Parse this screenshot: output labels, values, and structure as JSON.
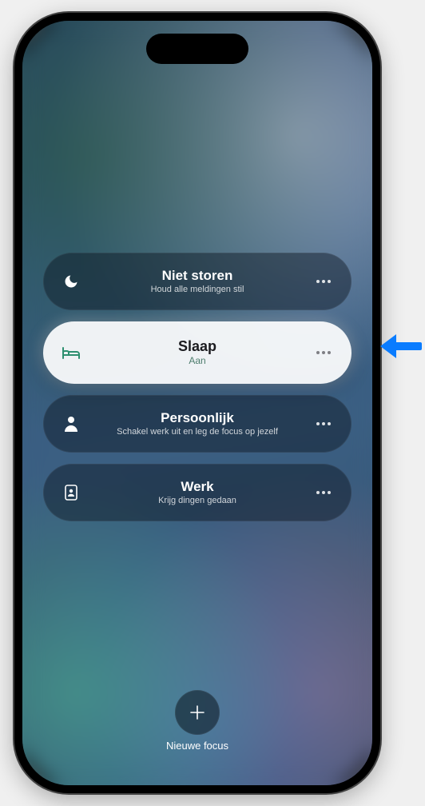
{
  "focus_modes": [
    {
      "id": "do-not-disturb",
      "icon": "moon",
      "title": "Niet storen",
      "subtitle": "Houd alle meldingen stil",
      "active": false
    },
    {
      "id": "sleep",
      "icon": "bed",
      "title": "Slaap",
      "subtitle": "Aan",
      "active": true
    },
    {
      "id": "personal",
      "icon": "person",
      "title": "Persoonlijk",
      "subtitle": "Schakel werk uit en leg de focus op jezelf",
      "active": false
    },
    {
      "id": "work",
      "icon": "badge",
      "title": "Werk",
      "subtitle": "Krijg dingen gedaan",
      "active": false
    }
  ],
  "new_focus": {
    "label": "Nieuwe focus"
  },
  "annotation": {
    "arrow_color": "#0a7cff"
  }
}
